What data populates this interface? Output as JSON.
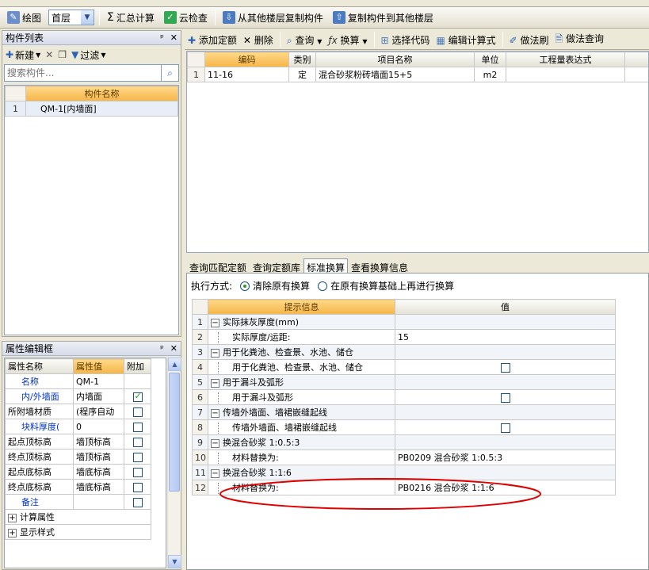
{
  "toolbar": {
    "items": [
      {
        "key": "draw",
        "label": "绘图",
        "icon": "pencil-icon"
      },
      {
        "key": "summary",
        "label": "汇总计算",
        "icon": "sigma-icon"
      },
      {
        "key": "cloud_check",
        "label": "云检查",
        "icon": "cloud-check-icon"
      },
      {
        "key": "copy_from",
        "label": "从其他楼层复制构件",
        "icon": "copy-from-floor-icon"
      },
      {
        "key": "copy_to",
        "label": "复制构件到其他楼层",
        "icon": "copy-to-floor-icon"
      }
    ],
    "floor": "首层"
  },
  "component_list": {
    "title": "构件列表",
    "new_label": "新建",
    "filter_label": "过滤",
    "search_placeholder": "搜索构件...",
    "column": "构件名称",
    "rows": [
      {
        "num": "1",
        "name": "QM-1[内墙面]"
      }
    ]
  },
  "props": {
    "title": "属性编辑框",
    "headers": [
      "属性名称",
      "属性值",
      "附加"
    ],
    "rows": [
      {
        "name": "名称",
        "value": "QM-1",
        "blue": true,
        "check": null
      },
      {
        "name": "内/外墙面",
        "value": "内墙面",
        "blue": true,
        "check": true
      },
      {
        "name": "所附墙材质",
        "value": "(程序自动",
        "blue": false,
        "check": false
      },
      {
        "name": "块料厚度(",
        "value": "0",
        "blue": true,
        "check": false
      },
      {
        "name": "起点顶标高",
        "value": "墙顶标高",
        "blue": false,
        "check": false
      },
      {
        "name": "终点顶标高",
        "value": "墙顶标高",
        "blue": false,
        "check": false
      },
      {
        "name": "起点底标高",
        "value": "墙底标高",
        "blue": false,
        "check": false
      },
      {
        "name": "终点底标高",
        "value": "墙底标高",
        "blue": false,
        "check": false
      },
      {
        "name": "备注",
        "value": "",
        "blue": true,
        "check": false
      }
    ],
    "groups": [
      "计算属性",
      "显示样式"
    ]
  },
  "quota_toolbar": {
    "items": [
      "添加定额",
      "删除",
      "查询",
      "换算",
      "选择代码",
      "编辑计算式",
      "做法刷",
      "做法查询"
    ]
  },
  "quota_table": {
    "headers": [
      "编码",
      "类别",
      "项目名称",
      "单位",
      "工程量表达式"
    ],
    "rows": [
      {
        "num": "1",
        "code": "11-16",
        "type": "定",
        "name": "混合砂浆粉砖墙面15+5",
        "unit": "m2",
        "expr": ""
      }
    ]
  },
  "tabs": [
    "查询匹配定额",
    "查询定额库",
    "标准换算",
    "查看换算信息"
  ],
  "active_tab": "标准换算",
  "exec": {
    "label": "执行方式:",
    "opt1": "清除原有换算",
    "opt2": "在原有换算基础上再进行换算"
  },
  "conv_table": {
    "headers": [
      "提示信息",
      "值"
    ],
    "rows": [
      {
        "num": "1",
        "group": true,
        "label": "实际抹灰厚度(mm)",
        "value": "",
        "check": false
      },
      {
        "num": "2",
        "group": false,
        "label": "实际厚度/运距:",
        "value": "15",
        "check": false
      },
      {
        "num": "3",
        "group": true,
        "label": "用于化粪池、检查景、水池、储仓",
        "value": "",
        "check": false
      },
      {
        "num": "4",
        "group": false,
        "label": "用于化粪池、检查景、水池、储仓",
        "value": "",
        "check": true
      },
      {
        "num": "5",
        "group": true,
        "label": "用于漏斗及弧形",
        "value": "",
        "check": false
      },
      {
        "num": "6",
        "group": false,
        "label": "用于漏斗及弧形",
        "value": "",
        "check": true
      },
      {
        "num": "7",
        "group": true,
        "label": "传墙外墙面、墙裙嵌缝起线",
        "value": "",
        "check": false
      },
      {
        "num": "8",
        "group": false,
        "label": "传墙外墙面、墙裙嵌缝起线",
        "value": "",
        "check": true
      },
      {
        "num": "9",
        "group": true,
        "label": "换混合砂浆 1:0.5:3",
        "value": "",
        "check": false
      },
      {
        "num": "10",
        "group": false,
        "label": "材料替换为:",
        "value": "PB0209  混合砂浆 1:0.5:3",
        "check": false
      },
      {
        "num": "11",
        "group": true,
        "label": "换混合砂浆 1:1:6",
        "value": "",
        "check": false
      },
      {
        "num": "12",
        "group": false,
        "label": "材料替换为:",
        "value": "PB0216  混合砂浆 1:1:6",
        "check": false
      }
    ]
  },
  "highlight_color": "#E00000"
}
